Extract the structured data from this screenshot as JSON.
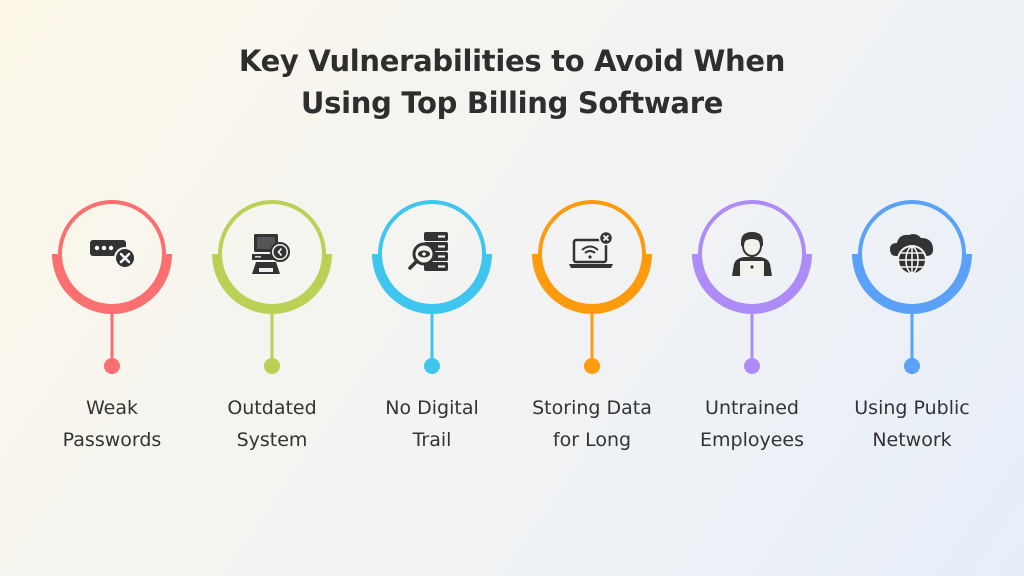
{
  "title": {
    "line1": "Key Vulnerabilities to Avoid When",
    "line2": "Using Top Billing Software"
  },
  "items": [
    {
      "icon": "password-error-icon",
      "color": "#fa7070",
      "line1": "Weak",
      "line2": "Passwords"
    },
    {
      "icon": "outdated-computer-icon",
      "color": "#b9d155",
      "line1": "Outdated",
      "line2": "System"
    },
    {
      "icon": "server-inspect-icon",
      "color": "#3fc6ee",
      "line1": "No Digital",
      "line2": "Trail"
    },
    {
      "icon": "laptop-wifi-off-icon",
      "color": "#fd9b0f",
      "line1": "Storing Data",
      "line2": "for Long"
    },
    {
      "icon": "employee-laptop-icon",
      "color": "#ad8cf7",
      "line1": "Untrained",
      "line2": "Employees"
    },
    {
      "icon": "cloud-globe-icon",
      "color": "#5aa1f7",
      "line1": "Using Public",
      "line2": "Network"
    }
  ]
}
